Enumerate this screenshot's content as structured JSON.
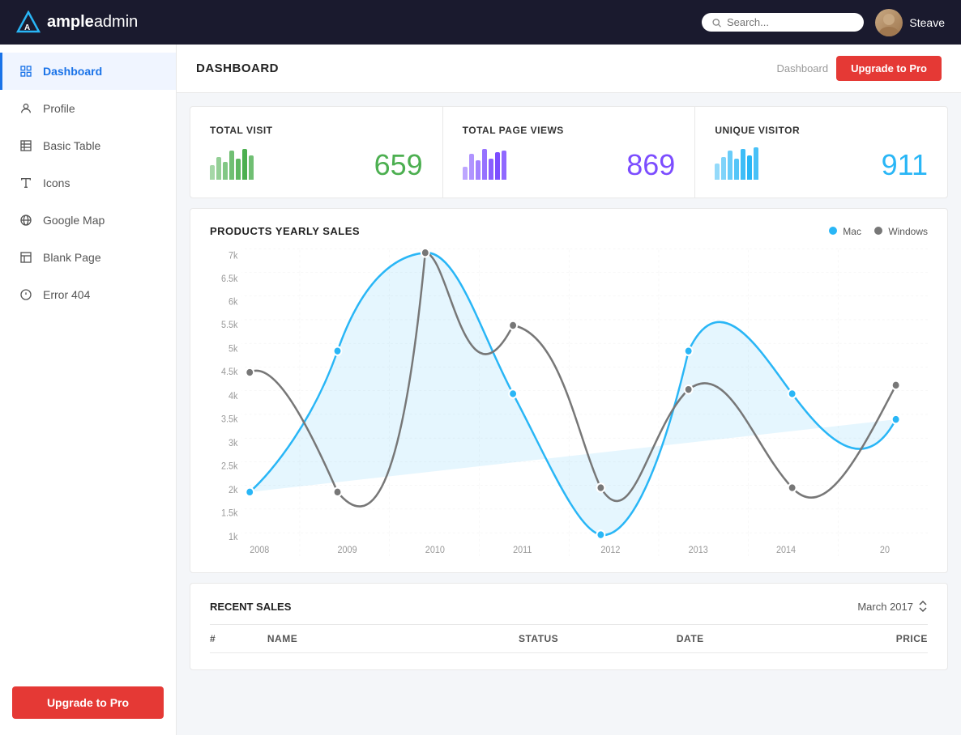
{
  "topnav": {
    "logo_bold": "ample",
    "logo_light": "admin",
    "search_placeholder": "Search...",
    "user_name": "Steave"
  },
  "sidebar": {
    "items": [
      {
        "id": "dashboard",
        "label": "Dashboard",
        "icon": "dashboard",
        "active": true
      },
      {
        "id": "profile",
        "label": "Profile",
        "icon": "person",
        "active": false
      },
      {
        "id": "basic-table",
        "label": "Basic Table",
        "icon": "table",
        "active": false
      },
      {
        "id": "icons",
        "label": "Icons",
        "icon": "font",
        "active": false
      },
      {
        "id": "google-map",
        "label": "Google Map",
        "icon": "globe",
        "active": false
      },
      {
        "id": "blank-page",
        "label": "Blank Page",
        "icon": "layout",
        "active": false
      },
      {
        "id": "error-404",
        "label": "Error 404",
        "icon": "info",
        "active": false
      }
    ],
    "upgrade_label": "Upgrade to Pro"
  },
  "content_header": {
    "title": "DASHBOARD",
    "breadcrumb": "Dashboard",
    "upgrade_label": "Upgrade to Pro"
  },
  "stats": [
    {
      "label": "TOTAL VISIT",
      "value": "659",
      "color": "green",
      "bars": [
        30,
        55,
        40,
        70,
        50,
        80,
        60
      ]
    },
    {
      "label": "TOTAL PAGE VIEWS",
      "value": "869",
      "color": "purple",
      "bars": [
        25,
        60,
        45,
        75,
        50,
        65,
        70
      ]
    },
    {
      "label": "UNIQUE VISITOR",
      "value": "911",
      "color": "blue",
      "bars": [
        35,
        50,
        65,
        45,
        70,
        55,
        80
      ]
    }
  ],
  "chart": {
    "title": "PRODUCTS YEARLY SALES",
    "legend": [
      {
        "label": "Mac",
        "color": "#29b6f6"
      },
      {
        "label": "Windows",
        "color": "#777"
      }
    ],
    "y_labels": [
      "7k",
      "6.5k",
      "6k",
      "5.5k",
      "5k",
      "4.5k",
      "4k",
      "3.5k",
      "3k",
      "2.5k",
      "2k",
      "1.5k",
      "1k"
    ],
    "x_labels": [
      "2008",
      "2009",
      "2010",
      "2011",
      "2012",
      "2013",
      "2014",
      "20"
    ]
  },
  "recent_sales": {
    "title": "RECENT SALES",
    "month": "March 2017",
    "columns": [
      "#",
      "NAME",
      "STATUS",
      "DATE",
      "PRICE"
    ]
  }
}
